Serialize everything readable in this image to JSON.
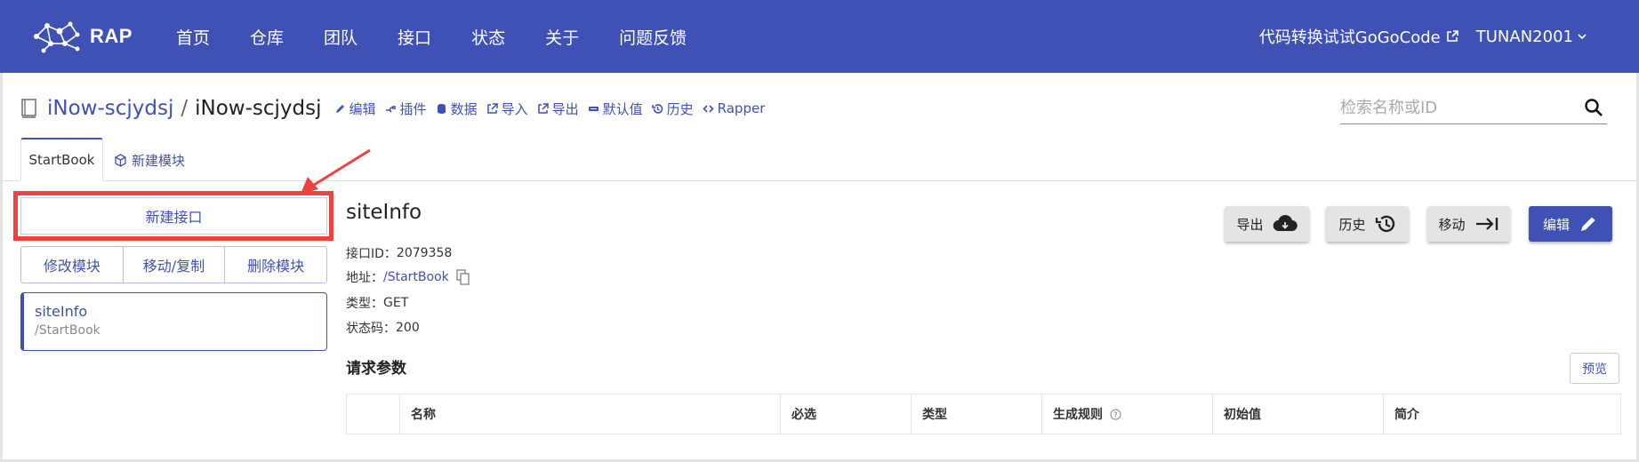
{
  "header": {
    "logo_text": "RAP",
    "nav": [
      "首页",
      "仓库",
      "团队",
      "接口",
      "状态",
      "关于",
      "问题反馈"
    ],
    "external_link": "代码转换试试GoGoCode",
    "user": "TUNAN2001"
  },
  "breadcrumb": {
    "org": "iNow-scjydsj",
    "separator": "/",
    "repo": "iNow-scjydsj",
    "actions": [
      {
        "label": "编辑",
        "icon": "pencil-icon"
      },
      {
        "label": "插件",
        "icon": "plug-icon"
      },
      {
        "label": "数据",
        "icon": "database-icon"
      },
      {
        "label": "导入",
        "icon": "external-link-icon"
      },
      {
        "label": "导出",
        "icon": "external-link-icon"
      },
      {
        "label": "默认值",
        "icon": "minus-box-icon"
      },
      {
        "label": "历史",
        "icon": "history-icon"
      },
      {
        "label": "Rapper",
        "icon": "code-brackets-icon"
      }
    ]
  },
  "search": {
    "placeholder": "检索名称或ID"
  },
  "tabs": {
    "active": "StartBook",
    "new_module": "新建模块"
  },
  "sidebar": {
    "new_interface": "新建接口",
    "module_actions": [
      "修改模块",
      "移动/复制",
      "删除模块"
    ],
    "interfaces": [
      {
        "name": "siteInfo",
        "path": "/StartBook"
      }
    ]
  },
  "detail": {
    "title": "siteInfo",
    "id_label": "接口ID：",
    "id_value": "2079358",
    "url_label": "地址：",
    "url_value": "/StartBook",
    "type_label": "类型：",
    "type_value": "GET",
    "status_label": "状态码：",
    "status_value": "200",
    "buttons": {
      "export": "导出",
      "history": "历史",
      "move": "移动",
      "edit": "编辑"
    }
  },
  "request_params": {
    "title": "请求参数",
    "preview": "预览",
    "columns": [
      "名称",
      "必选",
      "类型",
      "生成规则",
      "初始值",
      "简介"
    ]
  },
  "colors": {
    "brand": "#3f51b5",
    "highlight": "#f04040"
  }
}
